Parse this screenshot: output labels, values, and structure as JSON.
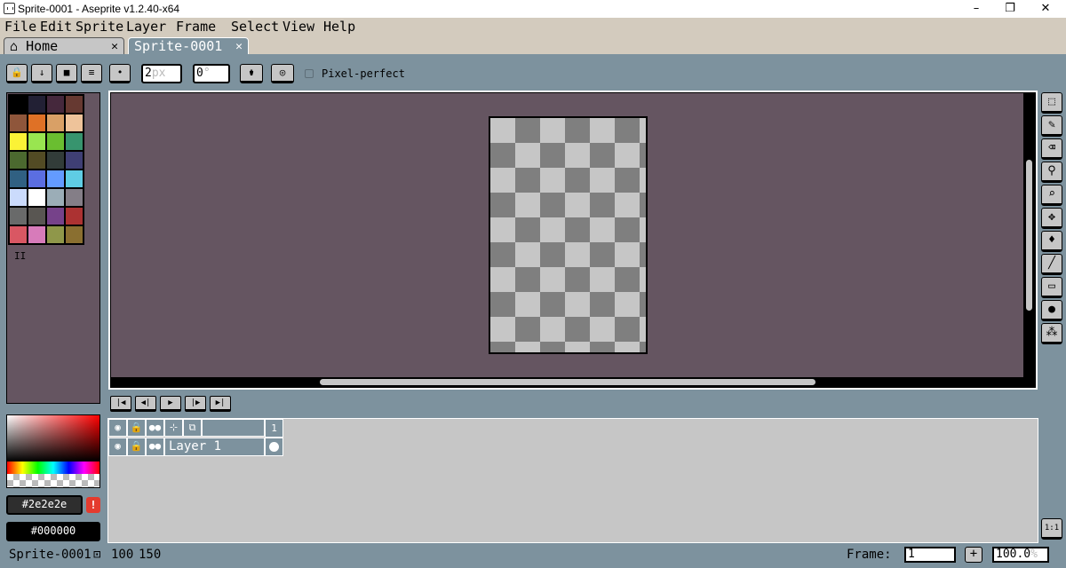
{
  "window": {
    "title": "Sprite-0001 - Aseprite v1.2.40-x64",
    "minimize": "–",
    "maximize": "❐",
    "close": "✕"
  },
  "menu": [
    "File",
    "Edit",
    "Sprite",
    "Layer",
    "Frame",
    "Select",
    "View",
    "Help"
  ],
  "tabs": [
    {
      "label": "Home",
      "close": "✕"
    },
    {
      "label": "Sprite-0001",
      "close": "✕"
    }
  ],
  "context_bar": {
    "brush_size": "2",
    "brush_size_unit": "px",
    "brush_angle": "0",
    "brush_angle_unit": "°",
    "pixel_perfect_label": "Pixel-perfect"
  },
  "palette": {
    "colors": [
      "#000000",
      "#222034",
      "#45283c",
      "#663931",
      "#8f563b",
      "#df7126",
      "#d9a066",
      "#eec39a",
      "#fbf236",
      "#99e550",
      "#6abe30",
      "#37946e",
      "#4b692f",
      "#524b24",
      "#323c39",
      "#3f3f74",
      "#306082",
      "#5b6ee1",
      "#639bff",
      "#5fcde4",
      "#cbdbfc",
      "#ffffff",
      "#9badb7",
      "#847e87",
      "#696a6a",
      "#595652",
      "#76428a",
      "#ac3232",
      "#d95763",
      "#d77bba",
      "#8f974a",
      "#8a6f30"
    ],
    "handle": "II"
  },
  "colors": {
    "foreground": "#2e2e2e",
    "background": "#000000",
    "warning": "!"
  },
  "toolbar_icons": [
    "marquee-icon",
    "pencil-icon",
    "eraser-icon",
    "eyedropper-icon",
    "zoom-icon",
    "move-icon",
    "paint-bucket-icon",
    "line-icon",
    "rectangle-icon",
    "blur-icon",
    "spray-icon"
  ],
  "tool_glyphs": [
    "⬚",
    "✎",
    "⌫",
    "⚲",
    "⌕",
    "✥",
    "♦",
    "╱",
    "▭",
    "●",
    "⁂"
  ],
  "animation": [
    "|◀",
    "◀|",
    "▶",
    "|▶",
    "▶|"
  ],
  "timeline": {
    "frame_number": "1",
    "layer_name": "Layer 1",
    "header_glyphs": [
      "◉",
      "🔒",
      "●●",
      "⊹",
      "⧉"
    ],
    "layer_glyphs": [
      "◉",
      "🔒",
      "●●"
    ]
  },
  "one_to_one": "1:1",
  "status": {
    "sprite_name": "Sprite-0001",
    "width": "100",
    "height": "150",
    "frame_label": "Frame:",
    "frame_value": "1",
    "add_frame": "+",
    "zoom_value": "100.0",
    "zoom_unit": "%"
  }
}
